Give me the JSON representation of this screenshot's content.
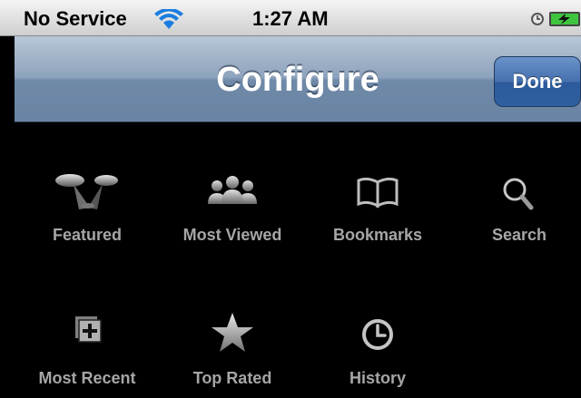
{
  "status_bar": {
    "carrier": "No Service",
    "time": "1:27 AM",
    "icons": [
      "wifi-icon",
      "alarm-icon",
      "battery-charging-icon"
    ]
  },
  "nav_bar": {
    "title": "Configure",
    "done_label": "Done"
  },
  "tab_items": [
    {
      "label": "Featured",
      "icon": "featured-icon"
    },
    {
      "label": "Most Viewed",
      "icon": "most-viewed-icon"
    },
    {
      "label": "Bookmarks",
      "icon": "bookmarks-icon"
    },
    {
      "label": "Search",
      "icon": "search-icon"
    },
    {
      "label": "Most Recent",
      "icon": "most-recent-icon"
    },
    {
      "label": "Top Rated",
      "icon": "top-rated-icon"
    },
    {
      "label": "History",
      "icon": "history-icon"
    }
  ],
  "colors": {
    "background": "#000000",
    "label": "#a6a6a6",
    "done_button": "#4570ad"
  }
}
